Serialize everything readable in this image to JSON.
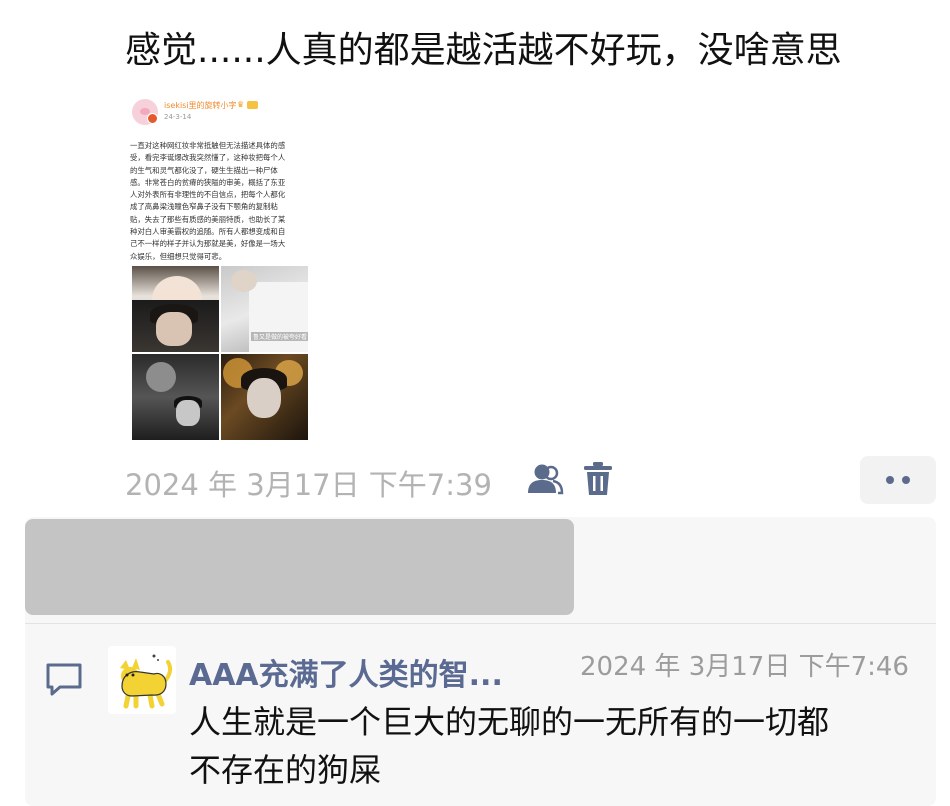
{
  "post": {
    "text": "感觉......人真的都是越活越不好玩，没啥意思",
    "timestamp": "2024 年 3月17日  下午7:39"
  },
  "embedded_post": {
    "username": "isekisi里的旋转小字",
    "date": "24-3-14",
    "body_lines": [
      "一直对这种网红妆非常抵触但无法描述具体的感",
      "受，看完李诞爆改我突然懂了，这种妆把每个人",
      "的生气和灵气都化没了，硬生生描出一种尸体",
      "感。非常苍白的贫瘠的狭隘的审美，概括了东亚",
      "人对外表所有非理性的不自信点，把每个人都化",
      "成了高鼻梁浅瞳色窄鼻子没有下颚角的复制粘",
      "贴，失去了那些有质感的美丽特质，也助长了某",
      "种对白人审美霸权的追随。所有人都想变成和自",
      "己不一样的样子并认为那就是美，好像是一场大",
      "众娱乐，但细想只觉得可悲。"
    ],
    "image_caption": "鲁又是做的被夸好看"
  },
  "actions": {
    "people_icon": "people-icon",
    "trash_icon": "trash-icon",
    "more_icon": "more-icon"
  },
  "comment": {
    "author": "AAA充满了人类的智...",
    "time": "2024 年 3月17日  下午7:46",
    "text_lines": [
      "人生就是一个巨大的无聊的一无所有的一切都",
      "不存在的狗屎"
    ]
  },
  "colors": {
    "name_link": "#5a6a92",
    "timestamp_gray": "#b3b3b3",
    "icon_blue": "#5b6b8c"
  }
}
